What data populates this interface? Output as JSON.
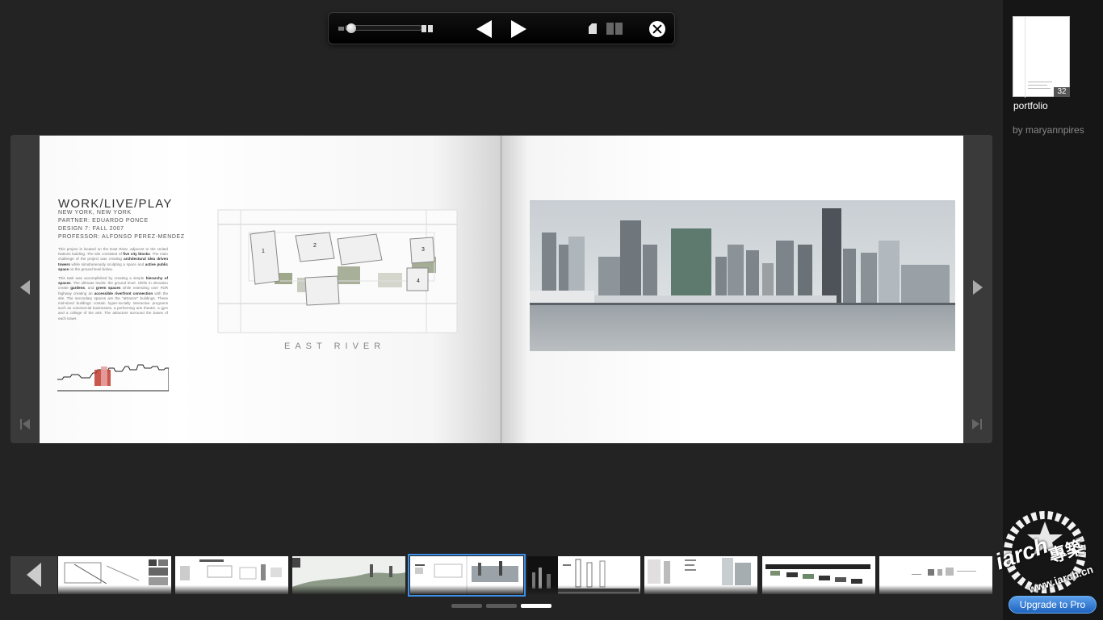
{
  "toolbar": {
    "buttons": [
      "zoom-out",
      "zoom-slider",
      "zoom-in",
      "previous-page",
      "next-page",
      "single-page-view",
      "double-page-view",
      "close"
    ]
  },
  "book": {
    "left_page": {
      "title": "WORK/LIVE/PLAY",
      "lines": [
        "NEW YORK, NEW YORK",
        "PARTNER: EDUARDO PONCE",
        "DESIGN 7: FALL 2007",
        "PROFESSOR: ALFONSO PEREZ-MENDEZ"
      ],
      "description_p1_a": "This project is located on the East River, adjacent to the United Nations building. The site consisted of ",
      "description_p1_b1": "five city blocks",
      "description_p1_c": ". The main challenge of the project was creating ",
      "description_p1_b2": "architectural idea driven towers",
      "description_p1_d": " while simultaneously sculpting a space and ",
      "description_p1_b3": "active public space",
      "description_p1_e": " on the ground level below.",
      "description_p2_a": "This task was accomplished by creating a simple ",
      "description_p2_b1": "hierarchy of spaces",
      "description_p2_c": ". The ultimate levels: the ground level. Shifts in elevation create ",
      "description_p2_b2": "gardens",
      "description_p2_d": ", and ",
      "description_p2_b3": "green spaces",
      "description_p2_e": " while extending over FDR highway creating an ",
      "description_p2_b4": "accessible riverfront connection",
      "description_p2_f": " with the site. The secondary spaces are the \"attractor\" buildings. These mid-sized buildings contain hyper-socially interactive programs such as commercial businesses, a performing arts theatre, a gym and a college of the arts. The attractors surround the bases of each tower.",
      "plan_labels": [
        "1",
        "2",
        "3",
        "4"
      ],
      "river_label": "EAST RIVER"
    }
  },
  "sidebar": {
    "page_count": "32",
    "title": "portfolio",
    "author": "by maryannpires",
    "upgrade_label": "Upgrade to Pro"
  },
  "watermark": {
    "brand": "iarch",
    "cn": "專築",
    "url": "www.iarch.cn"
  },
  "strip": {
    "selected_index": 3,
    "pages": 3,
    "current_page": 3
  },
  "colors": {
    "background": "#232323",
    "sidebar": "#161616",
    "selection": "#3d8ee6",
    "upgrade": "#2a72cf"
  }
}
